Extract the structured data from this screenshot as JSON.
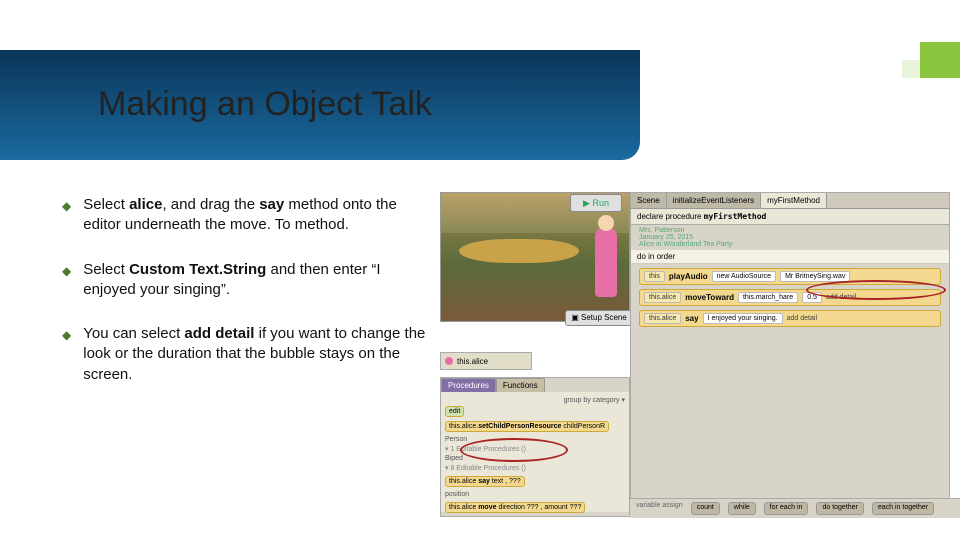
{
  "slide": {
    "title": "Making an Object Talk",
    "bullets": [
      {
        "prefix": "Select ",
        "b1": "alice",
        "mid1": ", and drag the ",
        "b2": "say",
        "suffix": " method onto the editor underneath the move. To method."
      },
      {
        "prefix": "Select ",
        "b1": "Custom Text.String",
        "mid1": " and then enter “I enjoyed your singing”.",
        "b2": "",
        "suffix": ""
      },
      {
        "prefix": "You can select ",
        "b1": "add detail",
        "mid1": " if you want to change the look or the duration that the bubble stays on the screen.",
        "b2": "",
        "suffix": ""
      }
    ]
  },
  "editor": {
    "tabs": {
      "scene": "Scene",
      "listeners": "initializeEventListeners",
      "method": "myFirstMethod"
    },
    "declare": "declare procedure",
    "declare_name": "myFirstMethod",
    "info1": "Mrs. Patterson",
    "info2": "January 25, 2015",
    "info3": "Alice in Wonderland Tea Party",
    "do_in_order": "do in order",
    "row1": {
      "obj": "this",
      "method": "playAudio",
      "arg1": "new AudioSource",
      "arg2": "Mr BritneySing.wav"
    },
    "row2": {
      "obj": "this.alice",
      "method": "moveToward",
      "arg1": "this.march_hare",
      "arg2": "0.5",
      "extra": "add detail"
    },
    "row3": {
      "obj": "this.alice",
      "method": "say",
      "arg1": "I enjoyed your singing.",
      "extra": "add detail"
    }
  },
  "buttons": {
    "run": "▶ Run",
    "setup": "▣ Setup Scene"
  },
  "selector": {
    "label": "this.alice"
  },
  "procPanel": {
    "tabs": {
      "procedures": "Procedures",
      "functions": "Functions"
    },
    "group": "group by category ▾",
    "edit": "edit",
    "row1": {
      "obj": "this.alice",
      "method": "setChildPersonResource",
      "arg": "childPersonR"
    },
    "sec1": "Person",
    "sec1row": "▾ 1 Editable Procedures ()",
    "sec2": "Biped",
    "sec2row": "▾ 8 Editable Procedures ()",
    "say": {
      "obj": "this.alice",
      "method": "say",
      "arg": "text",
      "extra": "???"
    },
    "pos": "position",
    "move": {
      "obj": "this.alice",
      "method": "move",
      "arg1": "direction ???",
      "arg2": "amount ???"
    }
  },
  "controls": [
    "count",
    "while",
    "for each in",
    "do together",
    "each in    together"
  ],
  "controls_left": "variable   assign"
}
